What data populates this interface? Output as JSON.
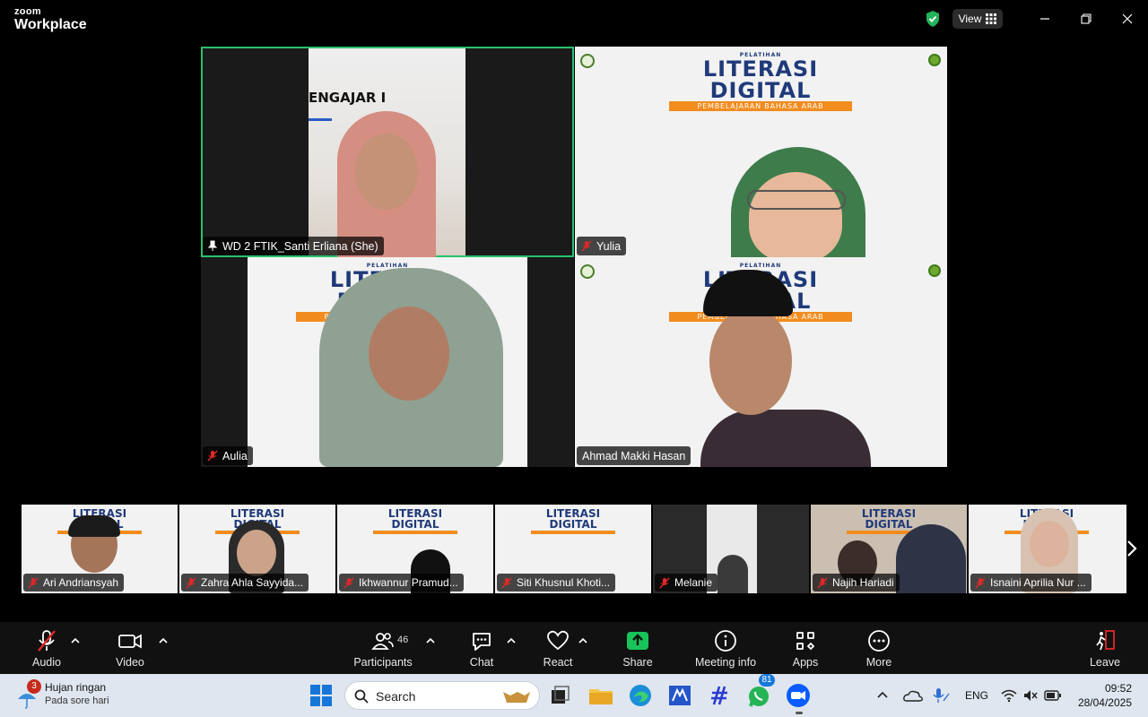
{
  "app": {
    "brand_top": "zoom",
    "brand_bottom": "Workplace",
    "view_label": "View"
  },
  "tiles": [
    {
      "name": "WD 2 FTIK_Santi Erliana (She)",
      "slide_text": "ENGAJAR I",
      "pinned": true
    },
    {
      "name": "Yulia"
    },
    {
      "name": "Aulia"
    },
    {
      "name": "Ahmad Makki Hasan"
    }
  ],
  "banner": {
    "pelatihan": "PELATIHAN",
    "title": "LITERASI DIGITAL",
    "subtitle": "PEMBELAJARAN BAHASA ARAB"
  },
  "strip": [
    {
      "name": "Ari Andriansyah"
    },
    {
      "name": "Zahra Ahla Sayyida..."
    },
    {
      "name": "Ikhwannur Pramud..."
    },
    {
      "name": "Siti Khusnul Khoti..."
    },
    {
      "name": "Melanie"
    },
    {
      "name": "Najih Hariadi"
    },
    {
      "name": "Isnaini Aprilia Nur ..."
    }
  ],
  "toolbar": {
    "audio": "Audio",
    "video": "Video",
    "participants": "Participants",
    "participants_count": "46",
    "chat": "Chat",
    "react": "React",
    "share": "Share",
    "meeting_info": "Meeting info",
    "apps": "Apps",
    "more": "More",
    "leave": "Leave"
  },
  "taskbar": {
    "weather_title": "Hujan ringan",
    "weather_sub": "Pada sore hari",
    "weather_badge": "3",
    "search_placeholder": "Search",
    "whatsapp_badge": "81",
    "language": "ENG",
    "time": "09:52",
    "date": "28/04/2025"
  },
  "colors": {
    "active_speaker": "#27c26f",
    "share_green": "#18c45a",
    "leave_red": "#e02828",
    "banner_blue": "#1f3a7a",
    "banner_orange": "#f28c1e"
  }
}
